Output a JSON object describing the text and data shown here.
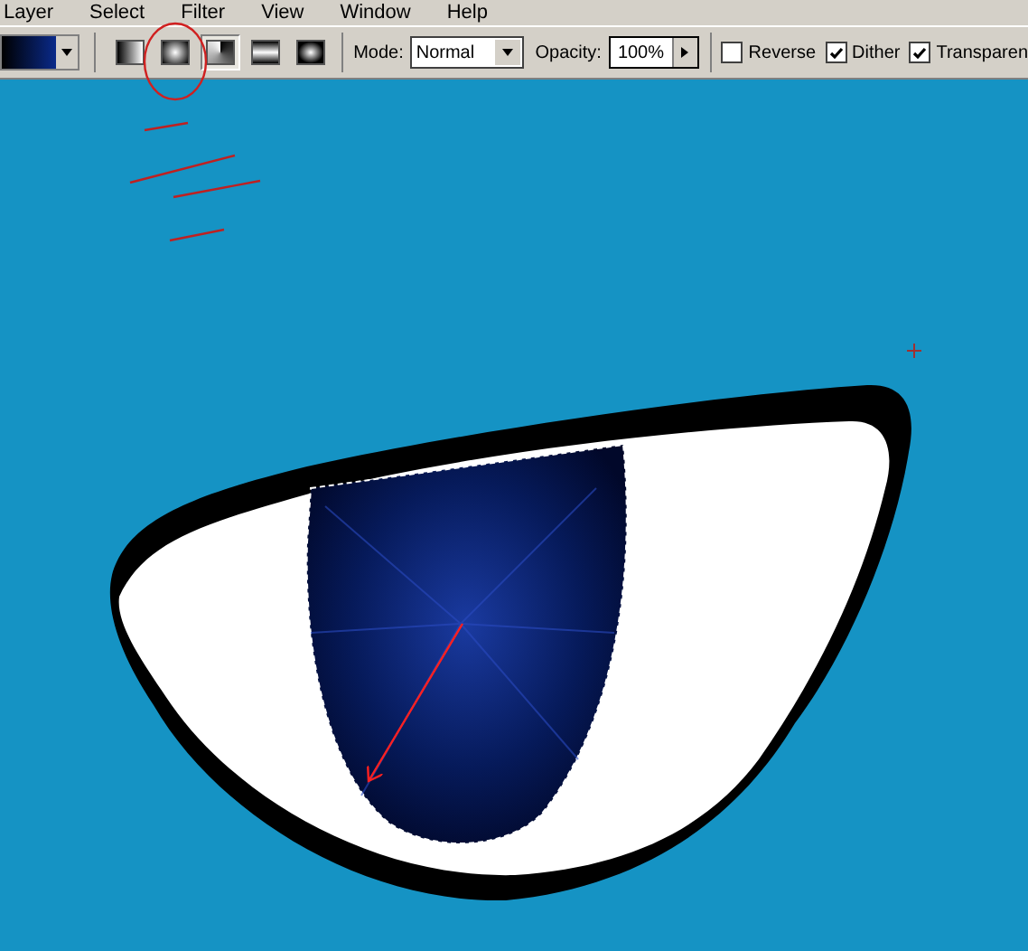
{
  "menu": [
    "Layer",
    "Select",
    "Filter",
    "View",
    "Window",
    "Help"
  ],
  "options_bar": {
    "gradient_types": [
      {
        "kind": "linear",
        "selected": false
      },
      {
        "kind": "radial",
        "selected": false
      },
      {
        "kind": "angle",
        "selected": true
      },
      {
        "kind": "reflected",
        "selected": false
      },
      {
        "kind": "diamond",
        "selected": false
      }
    ],
    "mode_label": "Mode:",
    "mode_value": "Normal",
    "opacity_label": "Opacity:",
    "opacity_value": "100%",
    "checkboxes": [
      {
        "label": "Reverse",
        "checked": false
      },
      {
        "label": "Dither",
        "checked": true
      },
      {
        "label": "Transparen",
        "checked": true
      }
    ]
  }
}
